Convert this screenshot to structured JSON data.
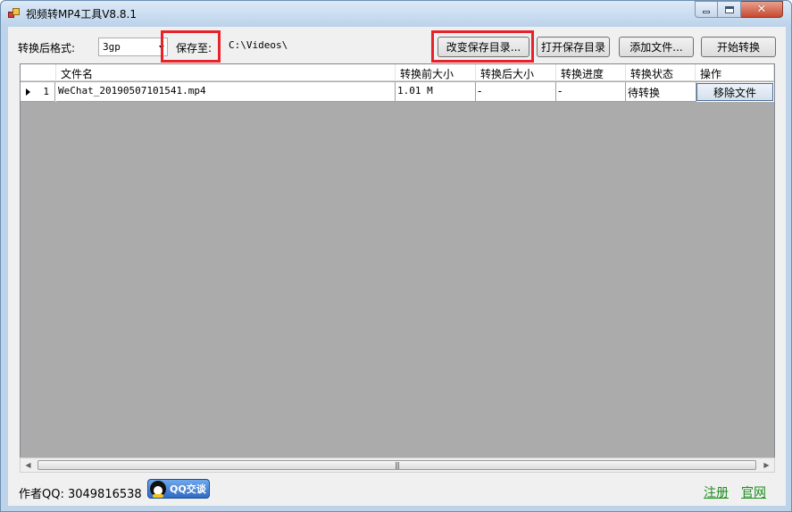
{
  "window": {
    "title": "视频转MP4工具V8.8.1",
    "close_label": "✕"
  },
  "toolbar": {
    "format_label": "转换后格式:",
    "format_value": "3gp",
    "save_to_label": "保存至:",
    "save_path": "C:\\Videos\\",
    "change_dir_button": "改变保存目录...",
    "open_dir_button": "打开保存目录",
    "add_file_button": "添加文件...",
    "start_button": "开始转换"
  },
  "table": {
    "columns": [
      "文件名",
      "转换前大小",
      "转换后大小",
      "转换进度",
      "转换状态",
      "操作"
    ],
    "rows": [
      {
        "index": "1",
        "filename": "WeChat_20190507101541.mp4",
        "size_before": "1.01 M",
        "size_after": "-",
        "progress": "-",
        "status": "待转换",
        "action": "移除文件"
      }
    ]
  },
  "scrollbar": {
    "left": "◀",
    "right": "▶",
    "grip": "|||"
  },
  "footer": {
    "author_qq": "作者QQ: 3049816538",
    "qq_chat": "QQ交谈",
    "register_link": "注册",
    "website_link": "官网"
  }
}
